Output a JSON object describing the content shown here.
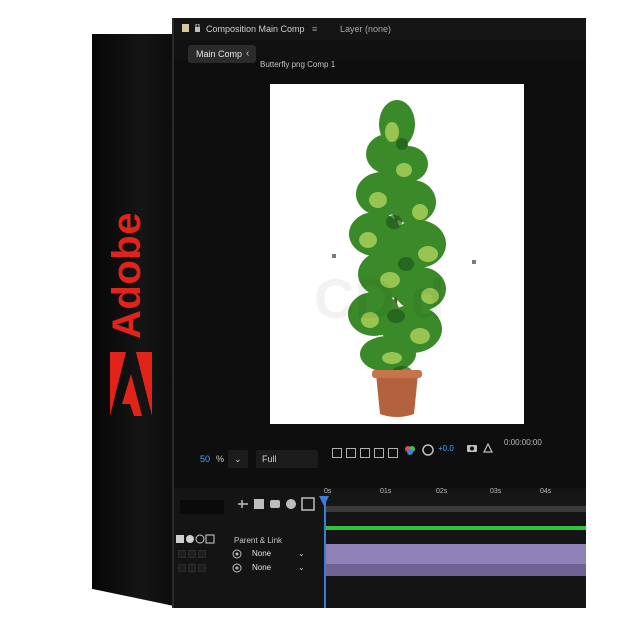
{
  "brand": {
    "name": "Adobe",
    "color": "#e2231a",
    "logo_icon": "adobe-a-icon"
  },
  "window": {
    "title": "Composition Main Comp",
    "menu_icon": "hamburger-icon",
    "layer_label": "Layer (none)"
  },
  "tabs": {
    "active": "Main Comp",
    "close_icon": "chevron-left-icon"
  },
  "breadcrumb": "Butterfly png Comp 1",
  "viewer": {
    "content": "potted-plant-image",
    "watermark": "CD          d"
  },
  "controls": {
    "zoom_value": "50",
    "zoom_unit": "%",
    "resolution": "Full",
    "exposure": "+0.0",
    "timecode": "0:00:00:00"
  },
  "timeline": {
    "ticks": [
      "0s",
      "01s",
      "02s",
      "03s",
      "04s"
    ],
    "column_header": "Parent & Link",
    "rows": [
      {
        "parent": "None"
      },
      {
        "parent": "None"
      }
    ],
    "work_area_color": "#31c23a",
    "layer_color": "#8f82b9",
    "playhead_color": "#3b7dd8"
  }
}
